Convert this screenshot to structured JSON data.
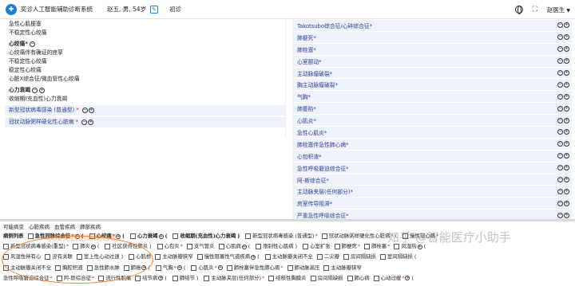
{
  "header": {
    "logo_glyph": "✚",
    "app_title": "奕诊人工智能辅助诊断系统",
    "patient": "赵五, 男, 54岁",
    "visit_type": "初诊",
    "expand_glyph": "⛶",
    "doctor": "赵医生",
    "caret": "▼"
  },
  "left_panel": {
    "pre_rows": [
      "急性心肌梗塞",
      "不稳定性心绞痛"
    ],
    "group1": {
      "title": "心绞痛*",
      "rows": [
        "心绞痛伴有确证的痉挛",
        "不稳定性心绞痛",
        "稳定性心绞痛",
        "心脏X综合征/微血管性心绞痛"
      ]
    },
    "group2": {
      "title": "心力衰竭",
      "rows": [
        "收缩期(充血性)心力衰竭"
      ]
    },
    "box_rows": [
      {
        "text": "新型冠状病毒感染 (普通型)",
        "star": "*"
      },
      {
        "text": "冠状动脉粥样硬化性心脏病",
        "star": "*"
      }
    ]
  },
  "icons": {
    "minus": "−",
    "plus": "+"
  },
  "right_panel": {
    "items": [
      {
        "text": "Takotsubo综合征/心碎综合征*"
      },
      {
        "text": "肺梗死*"
      },
      {
        "text": "肺栓塞*"
      },
      {
        "text": "心室颤动*"
      },
      {
        "text": "主动脉瘤破裂*"
      },
      {
        "text": "胸主动脉瘤破裂*"
      },
      {
        "text": "气胸*"
      },
      {
        "text": "肺萎陷*"
      },
      {
        "text": "心肌炎*"
      },
      {
        "text": "急性心肌炎*"
      },
      {
        "text": "肺栓塞伴急性肺心病*"
      },
      {
        "text": "心包积液*"
      },
      {
        "text": "急性呼吸窘迫综合征*"
      },
      {
        "text": "阿-斯综合征*"
      },
      {
        "text": "主动脉夹层(任何部分)*"
      },
      {
        "text": "房室传导阻滞*"
      },
      {
        "text": "严重急性呼吸综合征*"
      }
    ]
  },
  "bottom": {
    "category_tabs": [
      "可能病变",
      "心脏疾病",
      "血管疾病",
      "肺部疾病"
    ],
    "lines": [
      [
        {
          "text": "病例列表",
          "bold": true,
          "cb": false
        },
        {
          "text": "急性冠脉综合征",
          "bold": true,
          "cb": true,
          "star": "*",
          "pc": true,
          "paren": "("
        },
        {
          "text": "心绞痛",
          "bold": true,
          "cb": true,
          "star": "*",
          "pc": true,
          "paren": "("
        },
        {
          "text": "心力衰竭",
          "bold": true,
          "cb": true,
          "pc": true,
          "paren": "("
        },
        {
          "text": "收缩期(充血性)心力衰竭",
          "bold": true,
          "cb": true,
          "paren": ")"
        },
        {
          "text": "新型冠状病毒感染 (普通型)",
          "bold": false,
          "cb": true,
          "star": "*"
        },
        {
          "text": "冠状动脉粥样硬化性心脏病",
          "bold": false,
          "cb": true,
          "star": "*",
          "paren": "("
        },
        {
          "text": "慢性冠心病",
          "bold": false,
          "cb": true,
          "star": "*"
        }
      ],
      [
        {
          "text": "新型冠状病毒感染(重型)",
          "bold": false,
          "cb": true,
          "star": "*"
        },
        {
          "text": "肺炎",
          "bold": false,
          "cb": true,
          "pc": true,
          "paren": "("
        },
        {
          "text": "社区获得性肺炎",
          "bold": false,
          "cb": true,
          "paren": ")"
        },
        {
          "text": "心包炎",
          "bold": false,
          "cb": true,
          "star": "*"
        },
        {
          "text": "支气管炎",
          "bold": false,
          "cb": true
        },
        {
          "text": "心肌病",
          "bold": false,
          "cb": true,
          "pc": true,
          "paren": "("
        },
        {
          "text": "限制性心肌病",
          "bold": false,
          "cb": true,
          "paren": ")"
        },
        {
          "text": "心室扩张",
          "bold": false,
          "cb": true
        },
        {
          "text": "肺梗死",
          "bold": false,
          "cb": true,
          "star": "*"
        },
        {
          "text": "肺栓塞",
          "bold": false,
          "cb": true,
          "star": "*"
        },
        {
          "text": "风湿热",
          "bold": false,
          "cb": true,
          "pc": true,
          "paren": "("
        }
      ],
      [
        {
          "text": "风湿性伴有心",
          "bold": false,
          "cb": true
        },
        {
          "text": "没有关联",
          "bold": false,
          "cb": true
        },
        {
          "text": "室上性心动过速",
          "bold": false,
          "cb": true,
          "paren": ")"
        },
        {
          "text": "心肌桥",
          "bold": false,
          "cb": true
        },
        {
          "text": "主动脉瓣狭窄",
          "bold": false,
          "cb": true
        },
        {
          "text": "慢性阻塞性气道疾病",
          "bold": false,
          "cb": true,
          "pc": true,
          "paren": "("
        },
        {
          "text": "主动脉瓣关闭不全",
          "bold": false,
          "cb": true
        },
        {
          "text": "二尖瓣",
          "bold": false,
          "cb": true
        },
        {
          "text": "房间隔缺损",
          "bold": false,
          "cb": true
        },
        {
          "text": "室间隔缺损",
          "bold": false,
          "cb": true,
          "paren": "("
        }
      ],
      [
        {
          "text": "主动脉瓣关闭不全",
          "bold": false,
          "cb": true
        },
        {
          "text": "胸腔积液",
          "bold": false,
          "cb": true
        },
        {
          "text": "急性肺水肿",
          "bold": false,
          "cb": true
        },
        {
          "text": "肺癌",
          "bold": false,
          "cb": true,
          "pc": true,
          "paren": "("
        },
        {
          "text": "气胸",
          "bold": false,
          "cb": true,
          "star": "*",
          "pc": true,
          "paren": "("
        },
        {
          "text": "心肌炎",
          "bold": false,
          "cb": true,
          "star": "*",
          "pc": true
        },
        {
          "text": "肺栓塞伴急性肺心病",
          "bold": false,
          "cb": true,
          "star": "*"
        },
        {
          "text": "肺动脉高压",
          "bold": false,
          "cb": true
        },
        {
          "text": "主动脉瓣狭窄",
          "bold": false,
          "cb": true
        }
      ],
      [
        {
          "text": "急性呼吸窘迫综合征",
          "bold": false,
          "cb": false,
          "star": "*"
        },
        {
          "text": "阿-斯综合征",
          "bold": false,
          "cb": true,
          "star": "*"
        },
        {
          "text": "流行性肌痛",
          "bold": false,
          "cb": true
        },
        {
          "text": "结节病",
          "bold": false,
          "cb": true,
          "pc": true,
          "paren": "("
        },
        {
          "text": "肺结节",
          "bold": false,
          "cb": true,
          "paren": ")"
        },
        {
          "text": "主动脉夹层(任何部分)",
          "bold": false,
          "cb": true,
          "star": "*"
        },
        {
          "text": "结核性胸膜炎",
          "bold": false,
          "cb": true
        },
        {
          "text": "房间隔缺损",
          "bold": false,
          "cb": true
        },
        {
          "text": "肺心病",
          "bold": false,
          "cb": true
        },
        {
          "text": "心动过缓",
          "bold": false,
          "cb": true,
          "star": "*",
          "pc": true,
          "paren": "("
        }
      ]
    ]
  },
  "watermarks": {
    "orange": "以及免费的辅助诊断",
    "gray": "知乎 @智能医疗小助手"
  },
  "colors": {
    "accent": "#1e7fd6",
    "item_text": "#2d3c8c",
    "item_bg": "#eef2fa",
    "required": "#e02b2b",
    "highlight": "#f08030"
  }
}
